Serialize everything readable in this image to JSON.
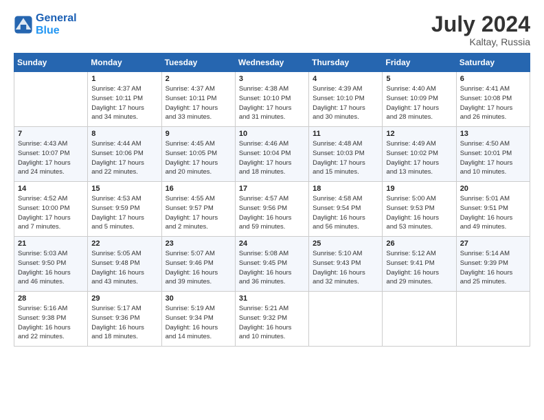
{
  "header": {
    "logo_line1": "General",
    "logo_line2": "Blue",
    "month_year": "July 2024",
    "location": "Kaltay, Russia"
  },
  "days_of_week": [
    "Sunday",
    "Monday",
    "Tuesday",
    "Wednesday",
    "Thursday",
    "Friday",
    "Saturday"
  ],
  "weeks": [
    [
      {
        "day": "",
        "info": ""
      },
      {
        "day": "1",
        "info": "Sunrise: 4:37 AM\nSunset: 10:11 PM\nDaylight: 17 hours\nand 34 minutes."
      },
      {
        "day": "2",
        "info": "Sunrise: 4:37 AM\nSunset: 10:11 PM\nDaylight: 17 hours\nand 33 minutes."
      },
      {
        "day": "3",
        "info": "Sunrise: 4:38 AM\nSunset: 10:10 PM\nDaylight: 17 hours\nand 31 minutes."
      },
      {
        "day": "4",
        "info": "Sunrise: 4:39 AM\nSunset: 10:10 PM\nDaylight: 17 hours\nand 30 minutes."
      },
      {
        "day": "5",
        "info": "Sunrise: 4:40 AM\nSunset: 10:09 PM\nDaylight: 17 hours\nand 28 minutes."
      },
      {
        "day": "6",
        "info": "Sunrise: 4:41 AM\nSunset: 10:08 PM\nDaylight: 17 hours\nand 26 minutes."
      }
    ],
    [
      {
        "day": "7",
        "info": "Sunrise: 4:43 AM\nSunset: 10:07 PM\nDaylight: 17 hours\nand 24 minutes."
      },
      {
        "day": "8",
        "info": "Sunrise: 4:44 AM\nSunset: 10:06 PM\nDaylight: 17 hours\nand 22 minutes."
      },
      {
        "day": "9",
        "info": "Sunrise: 4:45 AM\nSunset: 10:05 PM\nDaylight: 17 hours\nand 20 minutes."
      },
      {
        "day": "10",
        "info": "Sunrise: 4:46 AM\nSunset: 10:04 PM\nDaylight: 17 hours\nand 18 minutes."
      },
      {
        "day": "11",
        "info": "Sunrise: 4:48 AM\nSunset: 10:03 PM\nDaylight: 17 hours\nand 15 minutes."
      },
      {
        "day": "12",
        "info": "Sunrise: 4:49 AM\nSunset: 10:02 PM\nDaylight: 17 hours\nand 13 minutes."
      },
      {
        "day": "13",
        "info": "Sunrise: 4:50 AM\nSunset: 10:01 PM\nDaylight: 17 hours\nand 10 minutes."
      }
    ],
    [
      {
        "day": "14",
        "info": "Sunrise: 4:52 AM\nSunset: 10:00 PM\nDaylight: 17 hours\nand 7 minutes."
      },
      {
        "day": "15",
        "info": "Sunrise: 4:53 AM\nSunset: 9:59 PM\nDaylight: 17 hours\nand 5 minutes."
      },
      {
        "day": "16",
        "info": "Sunrise: 4:55 AM\nSunset: 9:57 PM\nDaylight: 17 hours\nand 2 minutes."
      },
      {
        "day": "17",
        "info": "Sunrise: 4:57 AM\nSunset: 9:56 PM\nDaylight: 16 hours\nand 59 minutes."
      },
      {
        "day": "18",
        "info": "Sunrise: 4:58 AM\nSunset: 9:54 PM\nDaylight: 16 hours\nand 56 minutes."
      },
      {
        "day": "19",
        "info": "Sunrise: 5:00 AM\nSunset: 9:53 PM\nDaylight: 16 hours\nand 53 minutes."
      },
      {
        "day": "20",
        "info": "Sunrise: 5:01 AM\nSunset: 9:51 PM\nDaylight: 16 hours\nand 49 minutes."
      }
    ],
    [
      {
        "day": "21",
        "info": "Sunrise: 5:03 AM\nSunset: 9:50 PM\nDaylight: 16 hours\nand 46 minutes."
      },
      {
        "day": "22",
        "info": "Sunrise: 5:05 AM\nSunset: 9:48 PM\nDaylight: 16 hours\nand 43 minutes."
      },
      {
        "day": "23",
        "info": "Sunrise: 5:07 AM\nSunset: 9:46 PM\nDaylight: 16 hours\nand 39 minutes."
      },
      {
        "day": "24",
        "info": "Sunrise: 5:08 AM\nSunset: 9:45 PM\nDaylight: 16 hours\nand 36 minutes."
      },
      {
        "day": "25",
        "info": "Sunrise: 5:10 AM\nSunset: 9:43 PM\nDaylight: 16 hours\nand 32 minutes."
      },
      {
        "day": "26",
        "info": "Sunrise: 5:12 AM\nSunset: 9:41 PM\nDaylight: 16 hours\nand 29 minutes."
      },
      {
        "day": "27",
        "info": "Sunrise: 5:14 AM\nSunset: 9:39 PM\nDaylight: 16 hours\nand 25 minutes."
      }
    ],
    [
      {
        "day": "28",
        "info": "Sunrise: 5:16 AM\nSunset: 9:38 PM\nDaylight: 16 hours\nand 22 minutes."
      },
      {
        "day": "29",
        "info": "Sunrise: 5:17 AM\nSunset: 9:36 PM\nDaylight: 16 hours\nand 18 minutes."
      },
      {
        "day": "30",
        "info": "Sunrise: 5:19 AM\nSunset: 9:34 PM\nDaylight: 16 hours\nand 14 minutes."
      },
      {
        "day": "31",
        "info": "Sunrise: 5:21 AM\nSunset: 9:32 PM\nDaylight: 16 hours\nand 10 minutes."
      },
      {
        "day": "",
        "info": ""
      },
      {
        "day": "",
        "info": ""
      },
      {
        "day": "",
        "info": ""
      }
    ]
  ]
}
